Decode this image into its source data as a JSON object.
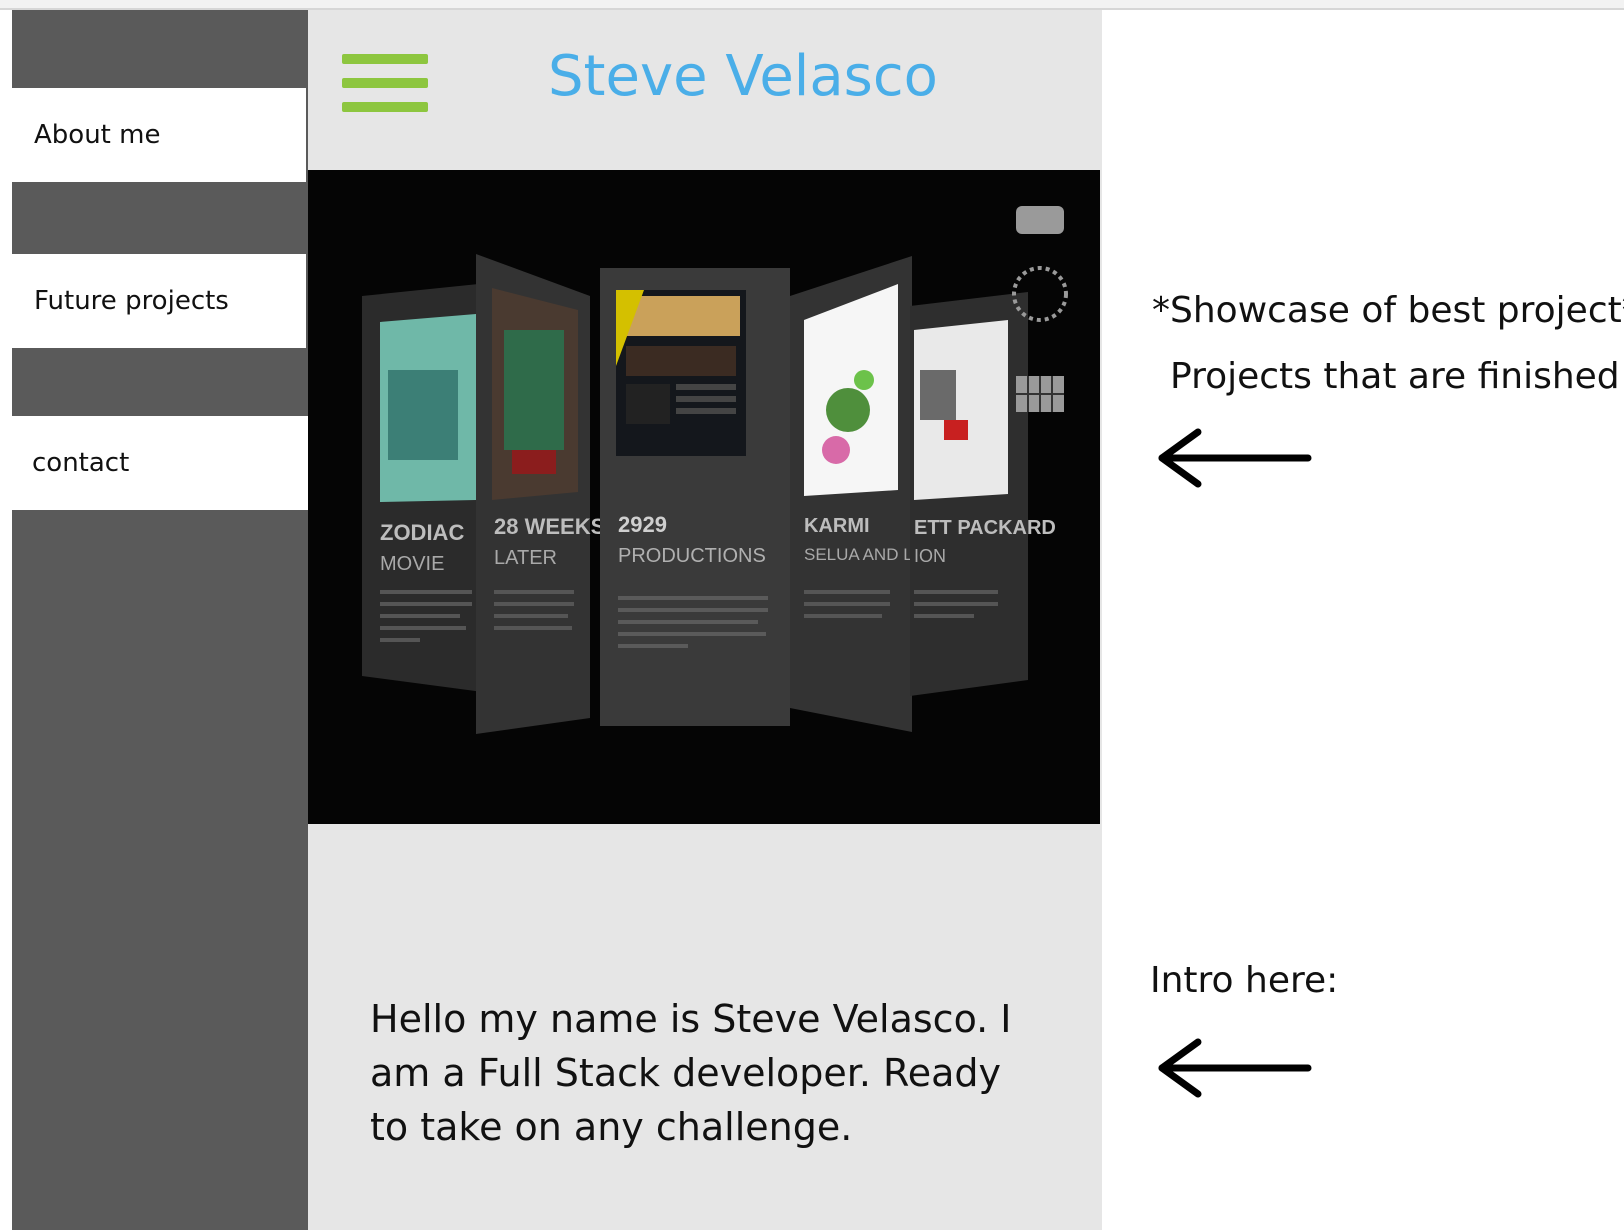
{
  "sidebar": {
    "items": [
      {
        "label": "About me"
      },
      {
        "label": "Future projects"
      },
      {
        "label": "contact"
      }
    ]
  },
  "header": {
    "title": "Steve Velasco",
    "menu_icon": "hamburger-menu-icon"
  },
  "carousel": {
    "cards": [
      {
        "title_line1": "ZODIAC",
        "title_line2": "MOVIE"
      },
      {
        "title_line1": "28 WEEKS",
        "title_line2": "LATER"
      },
      {
        "title_line1": "2929",
        "title_line2": "PRODUCTIONS"
      },
      {
        "title_line1": "KARMI",
        "title_line2": "SELUA AND LAMAI"
      },
      {
        "title_line1": "ETT PACKARD",
        "title_line2": "ION"
      }
    ],
    "active_index": 0,
    "dot_count": 3
  },
  "intro": {
    "text": "Hello my name is Steve Velasco. I am a Full Stack developer. Ready to take on any challenge."
  },
  "annotations": {
    "showcase": "*Showcase of best project*",
    "finished": "Projects that are finished",
    "intro_here": "Intro here:"
  },
  "colors": {
    "sidebar_bg": "#5a5a5a",
    "main_bg": "#e6e6e6",
    "title_color": "#4aaee8",
    "menu_icon_color": "#8dc63f",
    "dot_active": "#4aaee8",
    "dot_inactive": "#777777"
  }
}
